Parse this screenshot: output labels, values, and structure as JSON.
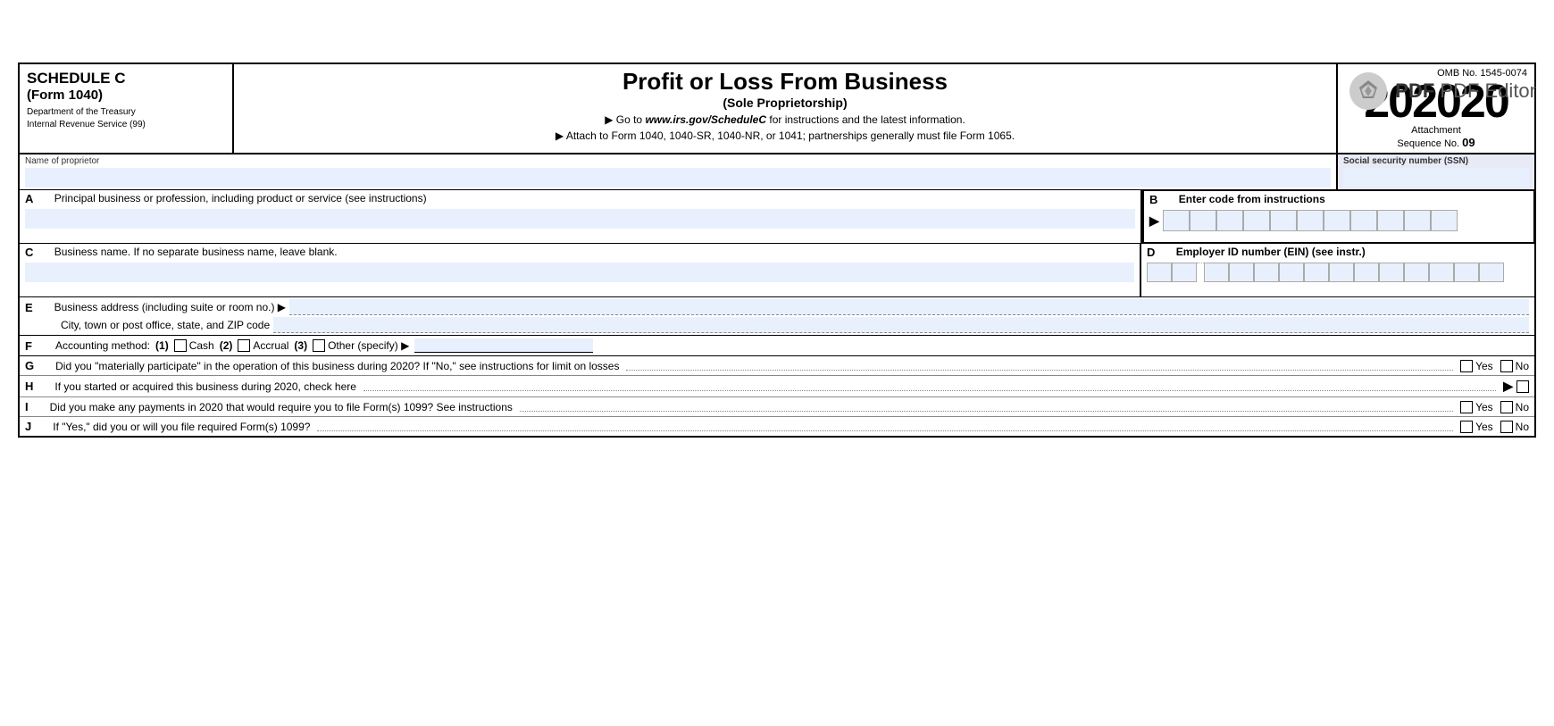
{
  "pdf_editor": {
    "label": "PDF Editor",
    "label_bold": "PDF"
  },
  "form": {
    "schedule_title": "SCHEDULE C",
    "form_number": "(Form 1040)",
    "dept": "Department of the Treasury",
    "irs": "Internal Revenue Service (99)",
    "main_title": "Profit or Loss From Business",
    "sub_title": "(Sole Proprietorship)",
    "instruction1": "▶ Go to www.irs.gov/ScheduleC for instructions and the latest information.",
    "instruction1_url": "www.irs.gov/ScheduleC",
    "instruction2": "▶ Attach to Form 1040, 1040-SR, 1040-NR, or 1041; partnerships generally must file Form 1065.",
    "omb": "OMB No. 1545-0074",
    "year": "2020",
    "attachment": "Attachment",
    "sequence": "Sequence No. 09",
    "name_label": "Name of proprietor",
    "ssn_label": "Social security number (SSN)",
    "row_a_letter": "A",
    "row_a_text": "Principal business or profession, including product or service (see instructions)",
    "row_b_letter": "B",
    "row_b_text": "Enter code from instructions",
    "row_c_letter": "C",
    "row_c_text": "Business name. If no separate business name, leave blank.",
    "row_d_letter": "D",
    "row_d_text": "Employer ID number (EIN) (see instr.)",
    "row_e_letter": "E",
    "row_e_text": "Business address (including suite or room no.) ▶",
    "row_e_city": "City, town or post office, state, and ZIP code",
    "row_f_letter": "F",
    "row_f_text": "Accounting method:",
    "row_f_1": "(1)",
    "row_f_cash": "Cash",
    "row_f_2": "(2)",
    "row_f_accrual": "Accrual",
    "row_f_3": "(3)",
    "row_f_other": "Other (specify) ▶",
    "row_g_letter": "G",
    "row_g_text": "Did you \"materially participate\" in the operation of this business during 2020? If \"No,\" see instructions for limit on losses",
    "row_g_yes": "Yes",
    "row_g_no": "No",
    "row_h_letter": "H",
    "row_h_text": "If you started or acquired this business during 2020, check here",
    "row_i_letter": "I",
    "row_i_text": "Did you make any payments in 2020 that would require you to file Form(s) 1099? See instructions",
    "row_i_yes": "Yes",
    "row_i_no": "No",
    "row_j_letter": "J",
    "row_j_text": "If \"Yes,\" did you or will you file required Form(s) 1099?",
    "row_j_yes": "Yes",
    "row_j_no": "No"
  }
}
